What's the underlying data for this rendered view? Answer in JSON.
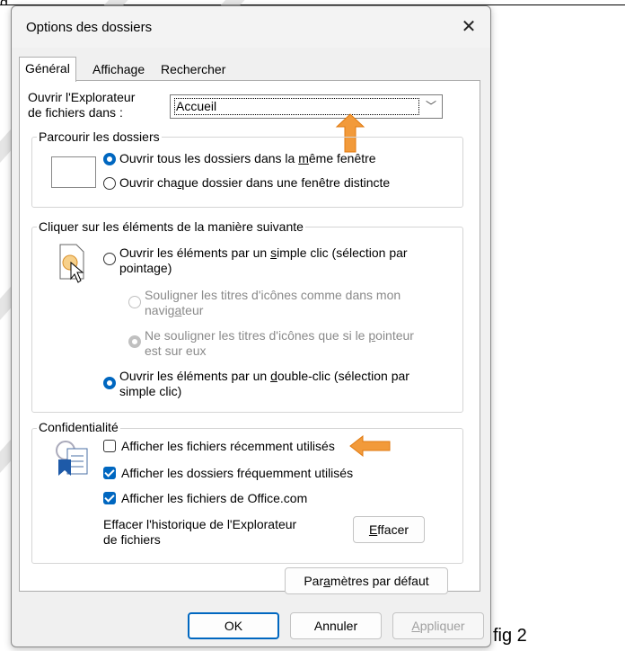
{
  "dialog": {
    "title": "Options des dossiers",
    "close_glyph": "✕"
  },
  "tabs": [
    {
      "label": "Général",
      "active": true
    },
    {
      "label": "Affichage",
      "active": false
    },
    {
      "label": "Rechercher",
      "active": false
    }
  ],
  "open_in": {
    "label_line1": "Ouvrir l'Explorateur",
    "label_line2": "de fichiers dans :",
    "value": "Accueil"
  },
  "browse": {
    "legend": "Parcourir les dossiers",
    "option_same_pre": "Ouvrir tous les dossiers dans la ",
    "option_same_u": "m",
    "option_same_post": "ême fenêtre",
    "option_separate_pre": "Ouvrir cha",
    "option_separate_u": "q",
    "option_separate_post": "ue dossier dans une fenêtre distincte"
  },
  "click": {
    "legend": "Cliquer sur les éléments de la manière suivante",
    "single_line1_pre": "Ouvrir les éléments par un ",
    "single_line1_u": "s",
    "single_line1_post": "imple clic (sélection par",
    "single_line2": "pointage)",
    "underline_browser_line1": "Souligner les titres d'icônes comme dans mon",
    "underline_browser_line2_pre": "navig",
    "underline_browser_line2_u": "a",
    "underline_browser_line2_post": "teur",
    "underline_hover_line1_pre": "Ne souligner les titres d'icônes que si le ",
    "underline_hover_line1_u": "p",
    "underline_hover_line1_post": "ointeur",
    "underline_hover_line2": "est sur eux",
    "double_line1_pre": "Ouvrir les éléments par un ",
    "double_line1_u": "d",
    "double_line1_post": "ouble-clic (sélection par",
    "double_line2": "simple clic)"
  },
  "privacy": {
    "legend": "Confidentialité",
    "recent_files": "Afficher les fichiers récemment utilisés",
    "frequent_folders": "Afficher les dossiers fréquemment utilisés",
    "office_files": "Afficher les fichiers de Office.com",
    "clear_history_line1": "Effacer l'historique de l'Explorateur",
    "clear_history_line2": "de fichiers",
    "clear_button_u": "E",
    "clear_button_rest": "ffacer"
  },
  "restore_defaults_pre": "Par",
  "restore_defaults_u": "a",
  "restore_defaults_post": "mètres par défaut",
  "footer": {
    "ok": "OK",
    "cancel": "Annuler",
    "apply_u": "A",
    "apply_rest": "ppliquer"
  },
  "caption": "fig 2",
  "peek_text": "g",
  "colors": {
    "accent": "#0067c0",
    "arrow": "#f29a3a"
  }
}
